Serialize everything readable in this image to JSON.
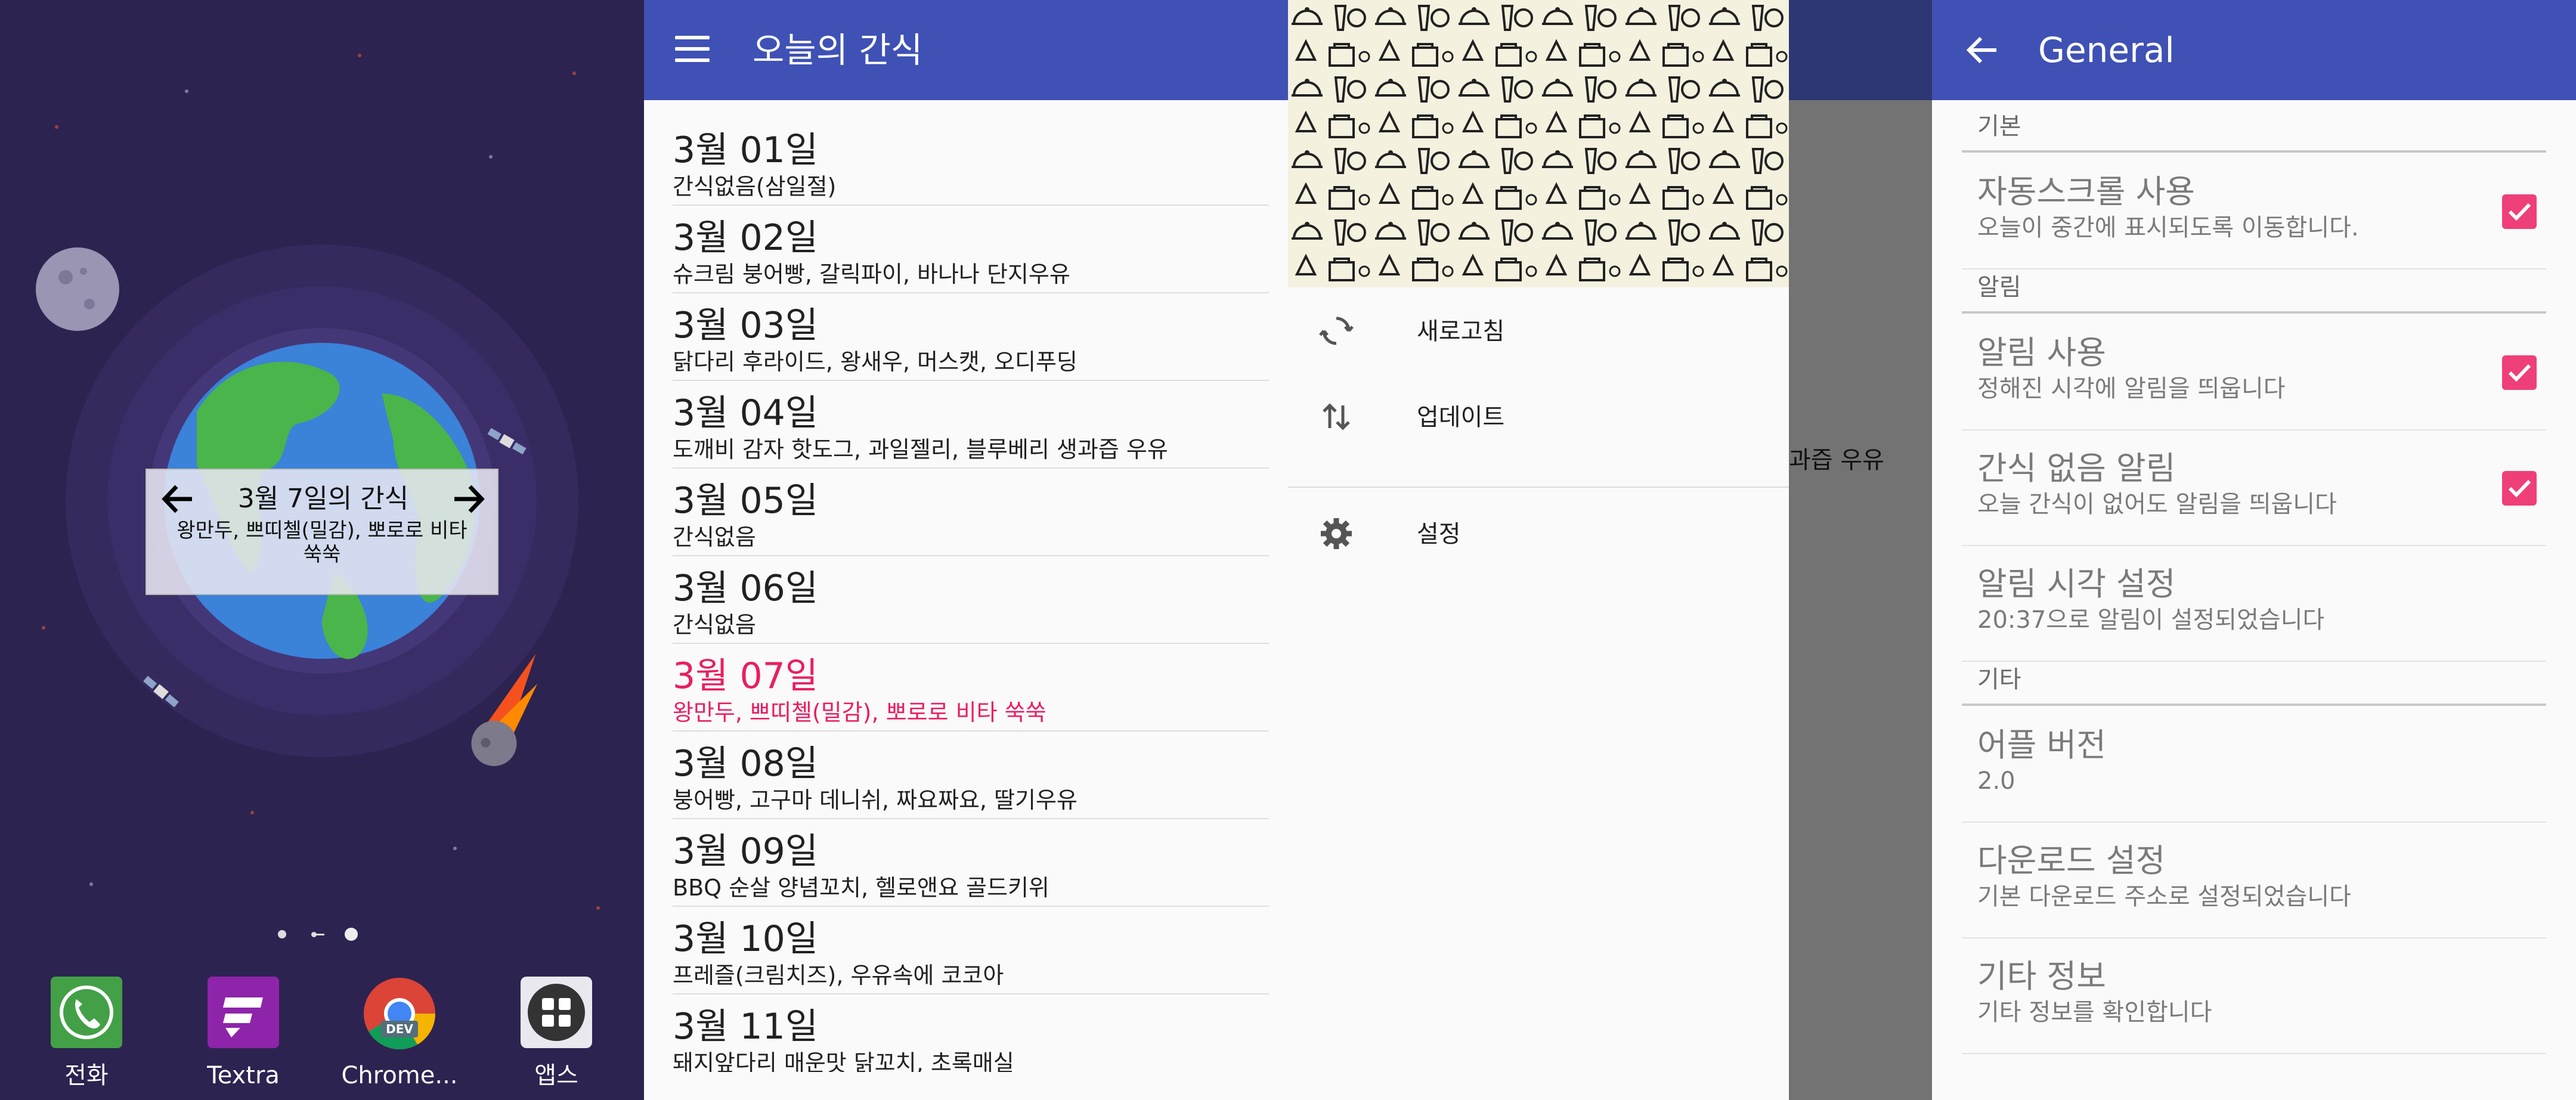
{
  "home": {
    "widget": {
      "title": "3월 7일의 간식",
      "text_line1": "왕만두, 쁘띠첼(밀감), 뽀로로 비타",
      "text_line2": "쑥쑥",
      "prev_icon": "arrow-left-icon",
      "next_icon": "arrow-right-icon"
    },
    "dock": [
      {
        "label": "전화",
        "icon": "phone-icon"
      },
      {
        "label": "Textra",
        "icon": "textra-icon"
      },
      {
        "label": "Chrome...",
        "icon": "chrome-dev-icon",
        "badge": "DEV"
      },
      {
        "label": "앱스",
        "icon": "apps-grid-icon"
      }
    ]
  },
  "list_screen": {
    "title": "오늘의 간식",
    "menu_icon": "hamburger-menu-icon",
    "days": [
      {
        "date": "3월 01일",
        "snack": "간식없음(삼일절)"
      },
      {
        "date": "3월 02일",
        "snack": "슈크림 붕어빵, 갈릭파이, 바나나 단지우유"
      },
      {
        "date": "3월 03일",
        "snack": "닭다리 후라이드, 왕새우, 머스캣, 오디푸딩"
      },
      {
        "date": "3월 04일",
        "snack": "도깨비 감자 핫도그, 과일젤리, 블루베리 생과즙 우유"
      },
      {
        "date": "3월 05일",
        "snack": "간식없음"
      },
      {
        "date": "3월 06일",
        "snack": "간식없음"
      },
      {
        "date": "3월 07일",
        "snack": "왕만두, 쁘띠첼(밀감), 뽀로로 비타 쑥쑥",
        "today": true
      },
      {
        "date": "3월 08일",
        "snack": "붕어빵, 고구마 데니쉬, 짜요짜요, 딸기우유"
      },
      {
        "date": "3월 09일",
        "snack": "BBQ 순살 양념꼬치,  헬로앤요 골드키위"
      },
      {
        "date": "3월 10일",
        "snack": "프레즐(크림치즈), 우유속에 코코아"
      },
      {
        "date": "3월 11일",
        "snack": "돼지앞다리 매운맛 닭꼬치, 초록매실"
      }
    ]
  },
  "drawer": {
    "items": [
      {
        "label": "새로고침",
        "icon": "refresh-icon"
      },
      {
        "label": "업데이트",
        "icon": "swap-vertical-icon"
      },
      {
        "label": "설정",
        "icon": "gear-icon"
      }
    ],
    "behind_text": "과즙 우유"
  },
  "settings": {
    "title": "General",
    "back_icon": "arrow-back-icon",
    "sections": [
      {
        "name": "기본",
        "prefs": [
          {
            "title": "자동스크롤 사용",
            "summary": "오늘이 중간에 표시되도록 이동합니다.",
            "checked": true
          }
        ]
      },
      {
        "name": "알림",
        "prefs": [
          {
            "title": "알림 사용",
            "summary": "정해진 시각에 알림을 띄웁니다",
            "checked": true
          },
          {
            "title": "간식 없음 알림",
            "summary": "오늘 간식이 없어도 알림을 띄웁니다",
            "checked": true
          },
          {
            "title": "알림 시각 설정",
            "summary": "20:37으로 알림이 설정되었습니다"
          }
        ]
      },
      {
        "name": "기타",
        "prefs": [
          {
            "title": "어플 버전",
            "summary": "2.0"
          },
          {
            "title": "다운로드 설정",
            "summary": "기본 다운로드 주소로 설정되었습니다"
          },
          {
            "title": "기타 정보",
            "summary": "기타 정보를 확인합니다"
          }
        ]
      }
    ]
  },
  "colors": {
    "primary": "#3f51b5",
    "accent": "#e91e63",
    "checkbox": "#ef3f78",
    "wallpaper": "#2d2350"
  }
}
